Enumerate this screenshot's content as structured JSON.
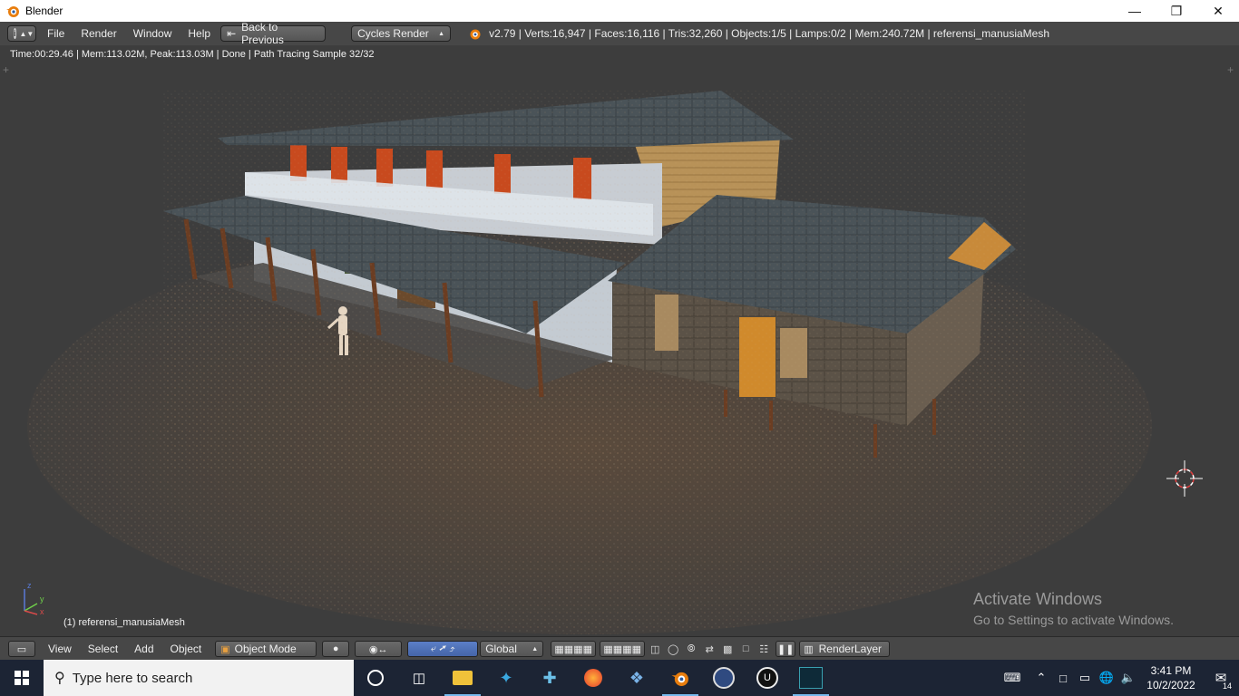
{
  "window": {
    "title": "Blender"
  },
  "colors": {
    "accent": "#5680c2",
    "header_bg": "#474747",
    "viewport_bg": "#3d3d3d",
    "taskbar_bg": "#1c2434"
  },
  "info_header": {
    "menus": [
      "File",
      "Render",
      "Window",
      "Help"
    ],
    "back_button": "Back to Previous",
    "engine": "Cycles Render",
    "stats": "v2.79 | Verts:16,947 | Faces:16,116 | Tris:32,260 | Objects:1/5 | Lamps:0/2 | Mem:240.72M | referensi_manusiaMesh"
  },
  "viewport": {
    "render_status": "Time:00:29.46 | Mem:113.02M, Peak:113.03M | Done | Path Tracing Sample 32/32",
    "selected_object": "(1) referensi_manusiaMesh",
    "axis": {
      "x": "x",
      "y": "y",
      "z": "z"
    },
    "watermark_title": "Activate Windows",
    "watermark_sub": "Go to Settings to activate Windows."
  },
  "view_header": {
    "menus": [
      "View",
      "Select",
      "Add",
      "Object"
    ],
    "mode": "Object Mode",
    "orientation": "Global",
    "render_layer": "RenderLayer"
  },
  "taskbar": {
    "search_placeholder": "Type here to search",
    "time": "3:41 PM",
    "date": "10/2/2022",
    "notifications": "14"
  }
}
